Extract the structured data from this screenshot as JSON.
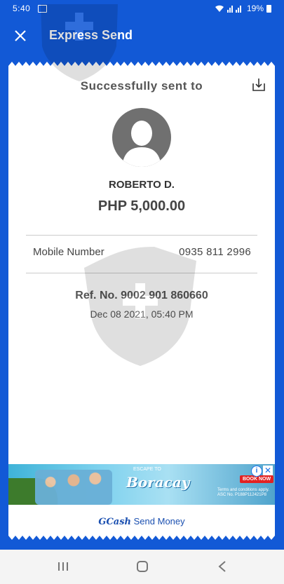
{
  "status_bar": {
    "time": "5:40",
    "battery": "19%"
  },
  "header": {
    "title": "Express Send"
  },
  "receipt": {
    "sent_label": "Successfully sent to",
    "recipient_name": "ROBERTO D.",
    "amount": "PHP 5,000.00",
    "mobile_label": "Mobile Number",
    "mobile_value": "0935 811 2996",
    "ref_number": "Ref. No. 9002 901 860660",
    "date": "Dec 08 2021, 05:40 PM"
  },
  "ad": {
    "headline": "Boracay",
    "tagline": "ESCAPE TO",
    "book_label": "BOOK NOW",
    "fine_print": "Terms and conditions apply. ASC No. P188P112421P8"
  },
  "footer": {
    "brand": "GCash",
    "text": "Send Money"
  },
  "colors": {
    "primary": "#1259d6",
    "avatar": "#707070"
  }
}
